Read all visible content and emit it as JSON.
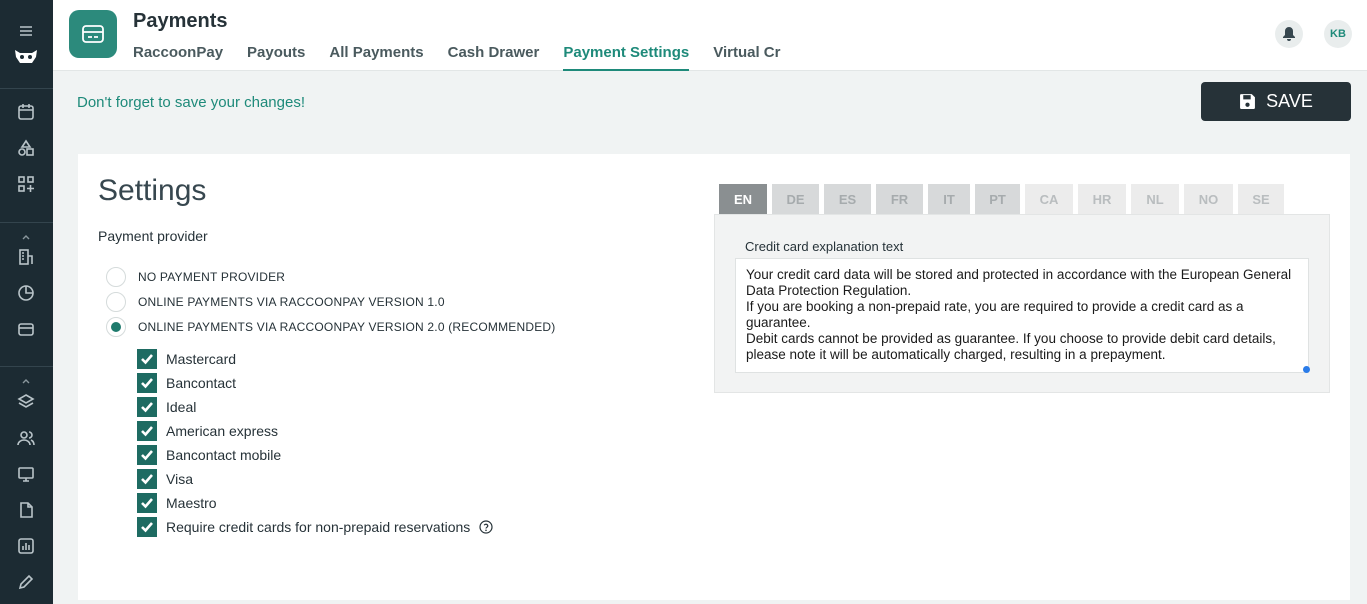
{
  "header": {
    "title": "Payments",
    "tabs": [
      {
        "label": "RaccoonPay",
        "active": false
      },
      {
        "label": "Payouts",
        "active": false
      },
      {
        "label": "All Payments",
        "active": false
      },
      {
        "label": "Cash Drawer",
        "active": false
      },
      {
        "label": "Payment Settings",
        "active": true
      },
      {
        "label": "Virtual Credit Cards",
        "active": false
      }
    ],
    "avatar_initials": "KB"
  },
  "savebar": {
    "message": "Don't forget to save your changes!",
    "save_label": "SAVE"
  },
  "settings": {
    "title": "Settings",
    "provider_label": "Payment provider",
    "providers": [
      {
        "label": "NO PAYMENT PROVIDER",
        "selected": false
      },
      {
        "label": "ONLINE PAYMENTS VIA RACCOONPAY VERSION 1.0",
        "selected": false
      },
      {
        "label": "ONLINE PAYMENTS VIA RACCOONPAY VERSION 2.0 (RECOMMENDED)",
        "selected": true
      }
    ],
    "methods": [
      {
        "label": "Mastercard",
        "checked": true
      },
      {
        "label": "Bancontact",
        "checked": true
      },
      {
        "label": "Ideal",
        "checked": true
      },
      {
        "label": "American express",
        "checked": true
      },
      {
        "label": "Bancontact mobile",
        "checked": true
      },
      {
        "label": "Visa",
        "checked": true
      },
      {
        "label": "Maestro",
        "checked": true
      },
      {
        "label": "Require credit cards for non-prepaid reservations",
        "checked": true
      }
    ]
  },
  "languages": [
    {
      "code": "EN",
      "state": "active"
    },
    {
      "code": "DE",
      "state": "filled"
    },
    {
      "code": "ES",
      "state": "filled"
    },
    {
      "code": "FR",
      "state": "filled"
    },
    {
      "code": "IT",
      "state": "filled"
    },
    {
      "code": "PT",
      "state": "filled"
    },
    {
      "code": "CA",
      "state": "empty"
    },
    {
      "code": "HR",
      "state": "empty"
    },
    {
      "code": "NL",
      "state": "empty"
    },
    {
      "code": "NO",
      "state": "empty"
    },
    {
      "code": "SE",
      "state": "empty"
    }
  ],
  "explanation": {
    "label": "Credit card explanation text",
    "text": "Your credit card data will be stored and protected in accordance with the European General Data Protection Regulation.\nIf you are booking a non-prepaid rate, you are required to provide a credit card as a guarantee.\nDebit cards cannot be provided as guarantee. If you choose to provide debit card details, please note it will be automatically charged, resulting in a prepayment."
  },
  "colors": {
    "accent": "#1e8a7a",
    "sidebar": "#1c2b33",
    "save_button": "#263238"
  },
  "icons": [
    "menu-icon",
    "raccoon-logo-icon",
    "calendar-icon",
    "shapes-icon",
    "apps-icon",
    "building-icon",
    "pie-chart-icon",
    "wallet-icon",
    "layers-icon",
    "users-icon",
    "payment-screen-icon",
    "document-icon",
    "stats-icon",
    "brush-icon",
    "bell-icon",
    "floppy-icon",
    "help-circle-icon"
  ]
}
